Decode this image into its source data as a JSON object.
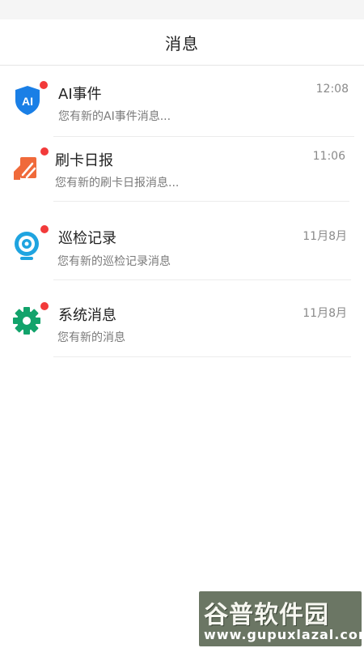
{
  "header": {
    "title": "消息"
  },
  "messages": [
    {
      "title": "AI事件",
      "preview": "您有新的AI事件消息...",
      "time": "12:08",
      "icon": "ai-shield-icon",
      "icon_color": "#1a7fe6",
      "unread": true
    },
    {
      "title": "刷卡日报",
      "preview": "您有新的刷卡日报消息...",
      "time": "11:06",
      "icon": "card-report-icon",
      "icon_color": "#f06a3a",
      "unread": true
    },
    {
      "title": "巡检记录",
      "preview": "您有新的巡检记录消息",
      "time": "11月8月",
      "icon": "patrol-camera-icon",
      "icon_color": "#1fa4e0",
      "unread": true
    },
    {
      "title": "系统消息",
      "preview": "您有新的消息",
      "time": "11月8月",
      "icon": "gear-icon",
      "icon_color": "#12a36b",
      "unread": true
    }
  ],
  "watermark": {
    "logo": "谷普软件园",
    "url": "www.gupuxlazal.com"
  },
  "colors": {
    "unread_dot": "#f23a3a",
    "divider": "#ececec"
  }
}
